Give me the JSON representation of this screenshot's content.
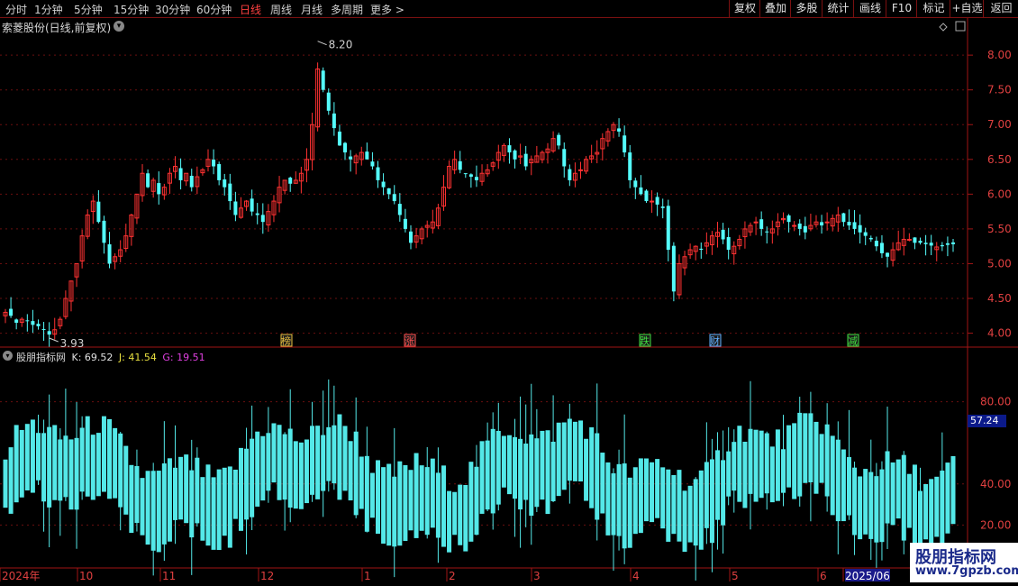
{
  "toolbar": {
    "periods": [
      {
        "label": "分时",
        "active": false
      },
      {
        "label": "1分钟",
        "active": false
      },
      {
        "label": "5分钟",
        "active": false
      },
      {
        "label": "15分钟",
        "active": false
      },
      {
        "label": "30分钟",
        "active": false
      },
      {
        "label": "60分钟",
        "active": false
      },
      {
        "label": "日线",
        "active": true
      },
      {
        "label": "周线",
        "active": false
      },
      {
        "label": "月线",
        "active": false
      },
      {
        "label": "多周期",
        "active": false
      },
      {
        "label": "更多 >",
        "active": false
      }
    ],
    "right_buttons": [
      "复权",
      "叠加",
      "多股",
      "统计",
      "画线",
      "F10",
      "标记",
      "+自选",
      "返回"
    ]
  },
  "price_panel": {
    "title": "索菱股份(日线,前复权)",
    "high_label": "8.20",
    "low_label": "3.93",
    "yaxis_ticks": [
      "8.00",
      "7.50",
      "7.00",
      "6.50",
      "6.00",
      "5.50",
      "5.00",
      "4.50",
      "4.00"
    ],
    "markers": [
      {
        "label": "榜",
        "color": "#e8c040"
      },
      {
        "label": "涨",
        "color": "#ff5050"
      },
      {
        "label": "跌",
        "color": "#40e040"
      },
      {
        "label": "财",
        "color": "#60b0ff"
      },
      {
        "label": "减",
        "color": "#40e040"
      }
    ]
  },
  "indicator_panel": {
    "name": "股朋指标网",
    "k_label": "K: 69.52",
    "j_label": "J: 41.54",
    "g_label": "G: 19.51",
    "yaxis_ticks": [
      "80.00",
      "40.00",
      "20.00"
    ],
    "current_value": "57.24"
  },
  "xaxis": {
    "labels": [
      "2024年",
      "10",
      "11",
      "12",
      "1",
      "2",
      "3",
      "4",
      "5",
      "6",
      "2025/06"
    ]
  },
  "watermark": {
    "line1": "股朋指标网",
    "line2": "www.7gpzb.com"
  },
  "chart_data": {
    "type": "candlestick",
    "price_range": [
      3.8,
      8.3
    ],
    "closes": [
      4.3,
      4.25,
      4.15,
      4.2,
      4.18,
      4.12,
      4.1,
      4.05,
      3.98,
      4.05,
      4.2,
      4.5,
      4.75,
      5.0,
      5.4,
      5.7,
      5.9,
      5.6,
      5.3,
      5.0,
      5.1,
      5.2,
      5.4,
      5.7,
      6.0,
      6.3,
      6.1,
      6.2,
      6.0,
      6.1,
      6.3,
      6.4,
      6.2,
      6.3,
      6.1,
      6.25,
      6.35,
      6.5,
      6.4,
      6.2,
      6.1,
      5.9,
      5.7,
      5.8,
      5.9,
      5.75,
      5.7,
      5.6,
      5.75,
      5.9,
      6.1,
      6.2,
      6.15,
      6.2,
      6.3,
      6.5,
      7.0,
      7.8,
      7.5,
      7.2,
      6.95,
      6.7,
      6.6,
      6.5,
      6.55,
      6.6,
      6.5,
      6.4,
      6.2,
      6.1,
      6.0,
      5.9,
      5.7,
      5.5,
      5.3,
      5.4,
      5.5,
      5.55,
      5.6,
      5.8,
      6.1,
      6.4,
      6.5,
      6.35,
      6.3,
      6.25,
      6.2,
      6.3,
      6.35,
      6.45,
      6.6,
      6.7,
      6.6,
      6.5,
      6.55,
      6.4,
      6.5,
      6.55,
      6.6,
      6.65,
      6.8,
      6.7,
      6.4,
      6.2,
      6.3,
      6.35,
      6.5,
      6.55,
      6.6,
      6.8,
      6.9,
      7.0,
      6.9,
      6.6,
      6.2,
      6.1,
      6.0,
      5.9,
      5.9,
      5.85,
      5.8,
      5.2,
      4.6,
      5.0,
      5.1,
      5.2,
      5.25,
      5.2,
      5.3,
      5.4,
      5.45,
      5.35,
      5.2,
      5.25,
      5.35,
      5.5,
      5.55,
      5.6,
      5.5,
      5.45,
      5.5,
      5.6,
      5.65,
      5.6,
      5.55,
      5.5,
      5.45,
      5.55,
      5.6,
      5.55,
      5.6,
      5.65,
      5.7,
      5.6,
      5.55,
      5.5,
      5.45,
      5.4,
      5.35,
      5.25,
      5.15,
      5.1,
      5.2,
      5.3,
      5.35,
      5.35,
      5.3,
      5.3,
      5.28,
      5.26,
      5.24,
      5.25,
      5.27,
      5.28
    ]
  }
}
